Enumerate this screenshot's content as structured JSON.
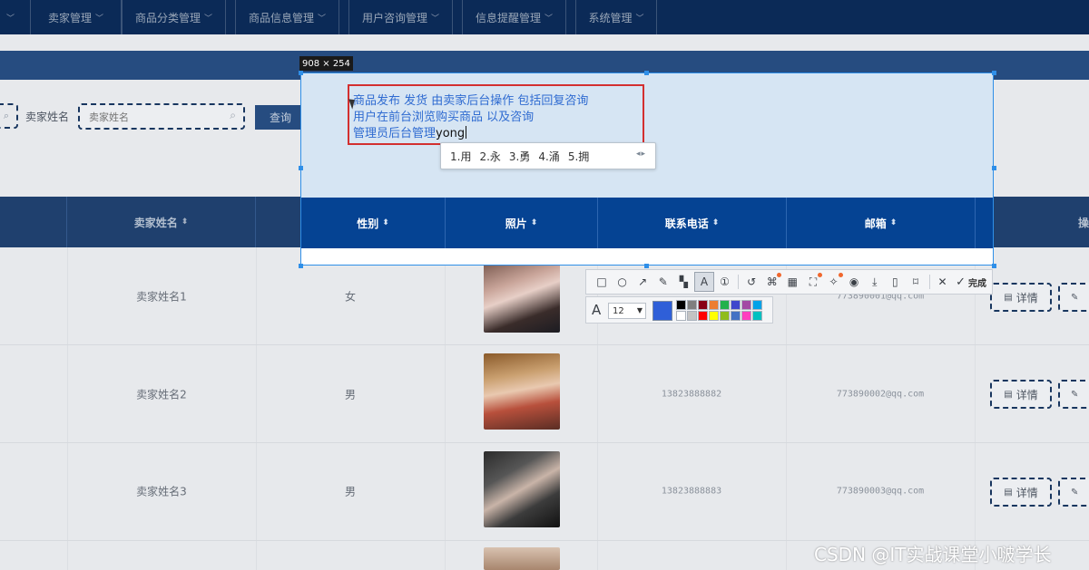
{
  "nav": {
    "items": [
      {
        "label": "卖家管理"
      },
      {
        "label": "商品分类管理"
      },
      {
        "label": "商品信息管理"
      },
      {
        "label": "用户咨询管理"
      },
      {
        "label": "信息提醒管理"
      },
      {
        "label": "系统管理"
      }
    ]
  },
  "search": {
    "label": "卖家姓名",
    "placeholder": "卖家姓名",
    "button": "查询"
  },
  "table": {
    "headers": [
      "卖家姓名",
      "性别",
      "照片",
      "联系电话",
      "邮箱",
      "操"
    ],
    "rows": [
      {
        "name": "卖家姓名1",
        "gender": "女",
        "phone": "",
        "email": "773890001@qq.com"
      },
      {
        "name": "卖家姓名2",
        "gender": "男",
        "phone": "13823888882",
        "email": "773890002@qq.com"
      },
      {
        "name": "卖家姓名3",
        "gender": "男",
        "phone": "13823888883",
        "email": "773890003@qq.com"
      }
    ],
    "detail_label": "详情",
    "detail_icon": "document-icon",
    "edit_icon": "edit-icon"
  },
  "capture": {
    "size": "908 × 254",
    "headers": [
      "性别",
      "照片",
      "联系电话",
      "邮箱"
    ]
  },
  "annotation": {
    "line1": "商品发布 发货  由卖家后台操作  包括回复咨询",
    "line2": "用户在前台浏览购买商品  以及咨询",
    "line3": "管理员后台管理",
    "typed": "yong"
  },
  "ime": {
    "candidates": [
      "1.用",
      "2.永",
      "3.勇",
      "4.涌",
      "5.拥"
    ]
  },
  "toolbar": {
    "icons": [
      "rectangle-icon",
      "ellipse-icon",
      "arrow-icon",
      "pen-icon",
      "mosaic-icon",
      "text-icon",
      "serial-number-icon",
      "undo-icon",
      "sticker-icon",
      "ocr-icon",
      "scan-icon",
      "pin-icon",
      "record-icon",
      "download-icon",
      "phone-icon",
      "bookmark-icon",
      "close-icon",
      "done-icon"
    ],
    "done_label": "完成",
    "font_size": "12",
    "current_color": "#2f5fd8",
    "palette": [
      "#000000",
      "#7f7f7f",
      "#880015",
      "#ed7d31",
      "#22b14c",
      "#3f48cc",
      "#a349a4",
      "#00a2e8",
      "#ffffff",
      "#c3c3c3",
      "#ff0000",
      "#ffff00",
      "#8fbc1b",
      "#4472c4",
      "#ff3fbf",
      "#00c0c0"
    ]
  },
  "watermark": "CSDN @IT实战课堂小啵学长"
}
